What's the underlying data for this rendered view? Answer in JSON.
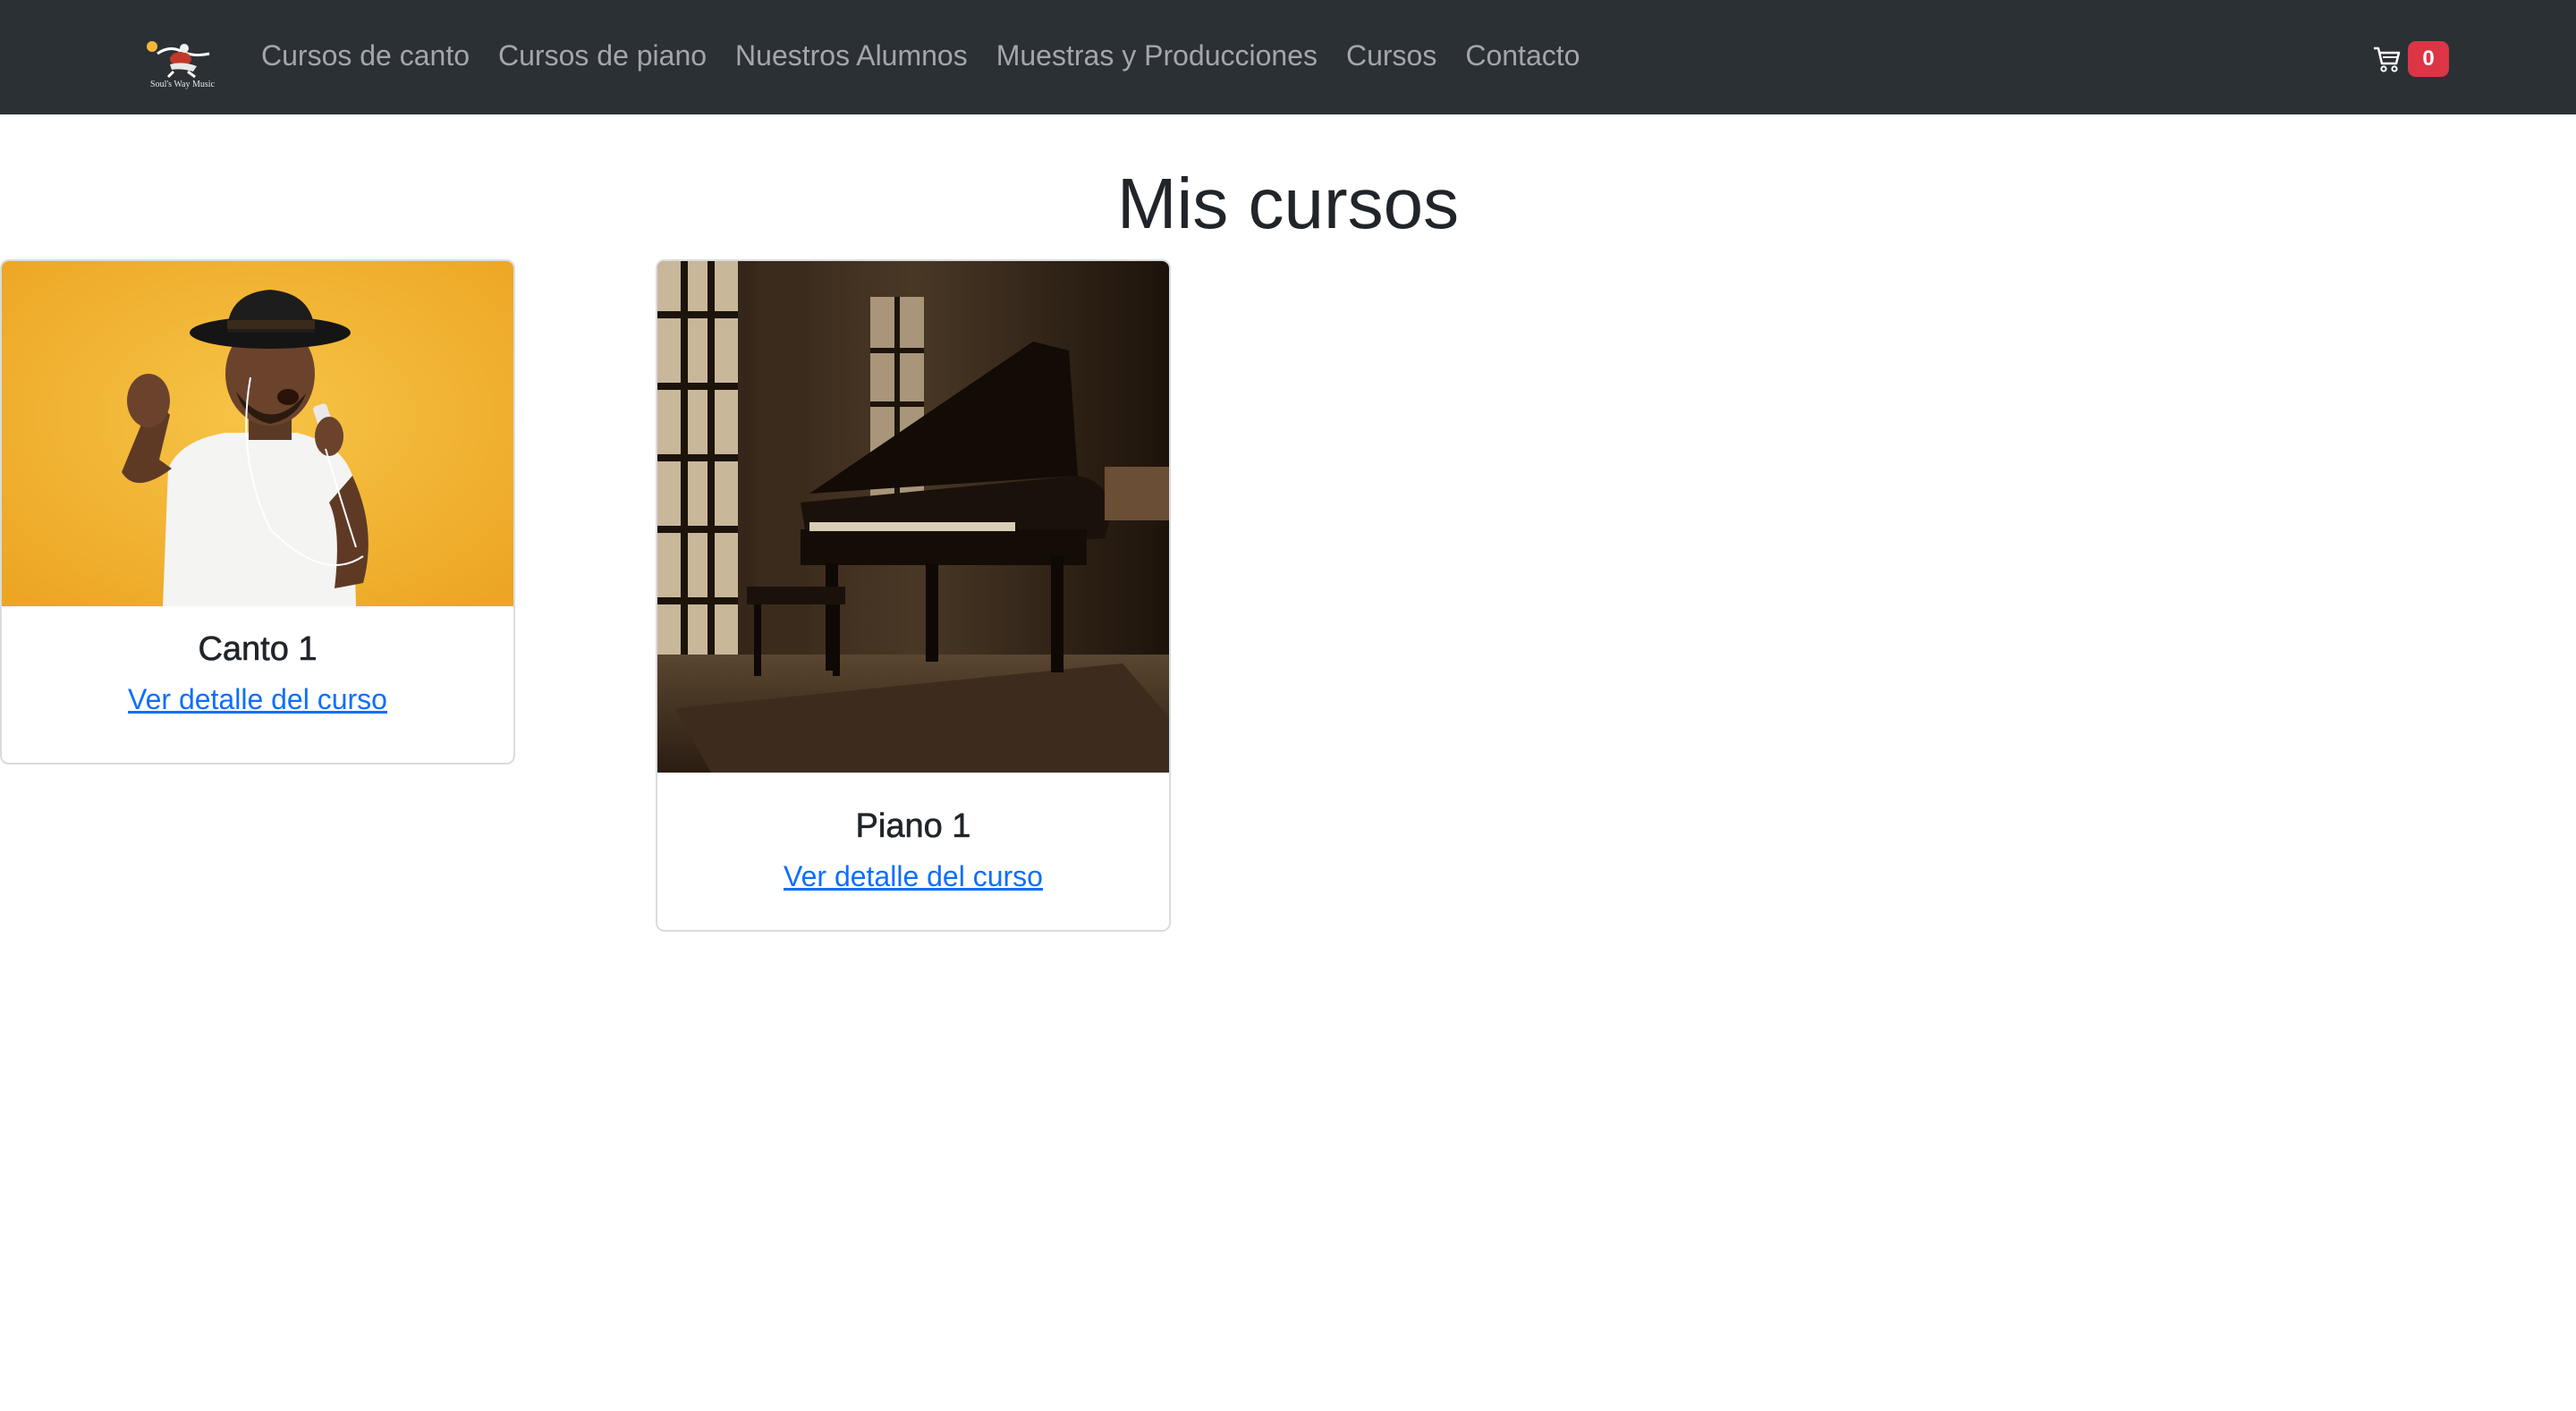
{
  "brand": {
    "name": "Soul's Way Music",
    "logo_icon": "singer-logo-icon"
  },
  "nav": {
    "links": [
      {
        "label": "Cursos de canto"
      },
      {
        "label": "Cursos de piano"
      },
      {
        "label": "Nuestros Alumnos"
      },
      {
        "label": "Muestras y Producciones"
      },
      {
        "label": "Cursos"
      },
      {
        "label": "Contacto"
      }
    ]
  },
  "cart": {
    "icon": "cart-icon",
    "count": "0",
    "badge_color": "#dc3545"
  },
  "page": {
    "title": "Mis cursos"
  },
  "courses": [
    {
      "title": "Canto 1",
      "link_label": "Ver detalle del curso",
      "image": "singer-with-hat-photo",
      "image_background": "#f2b62b"
    },
    {
      "title": "Piano 1",
      "link_label": "Ver detalle del curso",
      "image": "grand-piano-photo",
      "image_background": "#3b2a1a"
    }
  ],
  "colors": {
    "navbar": "#2b3035",
    "nav_text": "#a3a6aa",
    "link": "#0d6efd",
    "heading": "#212529"
  }
}
